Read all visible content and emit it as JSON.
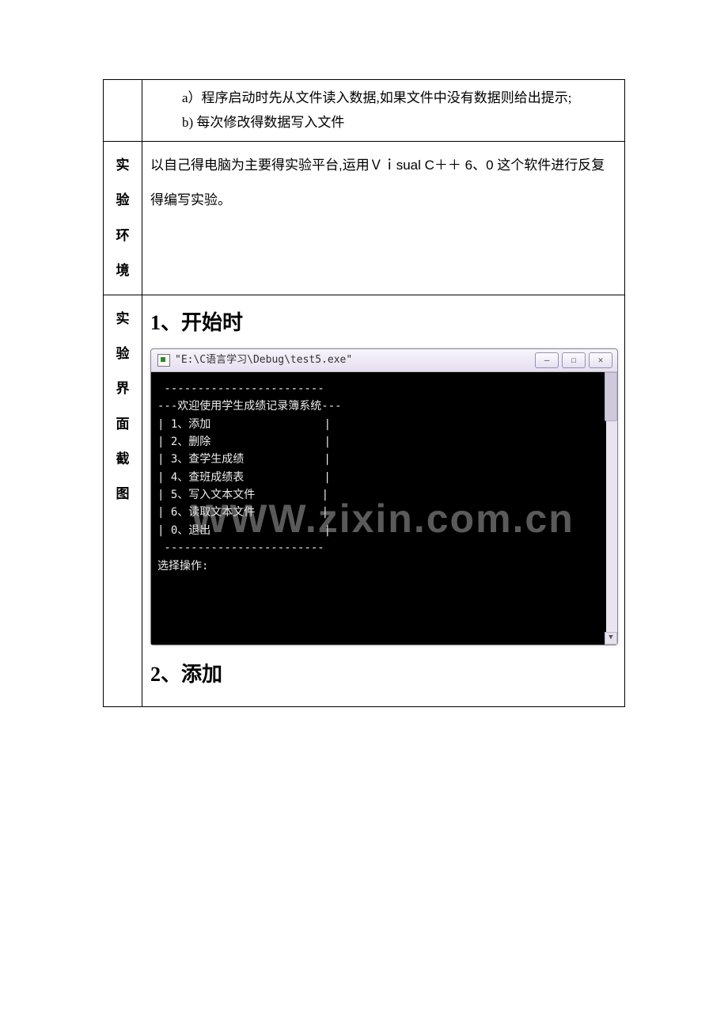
{
  "row1": {
    "line_a": "a）程序启动时先从文件读入数据,如果文件中没有数据则给出提示;",
    "line_b": "b)  每次修改得数据写入文件"
  },
  "row2": {
    "label": "实验环境",
    "text": "以自己得电脑为主要得实验平台,运用Ｖｉsual C＋＋ 6、0 这个软件进行反复得编写实验。"
  },
  "row3": {
    "label": "实验界面截图",
    "heading1": "1、开始时",
    "heading2": "2、添加",
    "console": {
      "title": "\"E:\\C语言学习\\Debug\\test5.exe\"",
      "lines": [
        " ------------------------",
        "---欢迎使用学生成绩记录簿系统---",
        "| 1、添加                 |",
        "",
        "| 2、删除                 |",
        "",
        "| 3、查学生成绩            |",
        "",
        "| 4、查班成绩表            |",
        "",
        "| 5、写入文本文件          |",
        "",
        "| 6、读取文本文件          |",
        "",
        "| 0、退出                 |",
        "",
        " ------------------------",
        "选择操作:"
      ],
      "watermark": "WWW.zixin.com.cn"
    }
  },
  "icons": {
    "min": "—",
    "max": "☐",
    "close": "✕",
    "up": "▲",
    "down": "▼"
  }
}
